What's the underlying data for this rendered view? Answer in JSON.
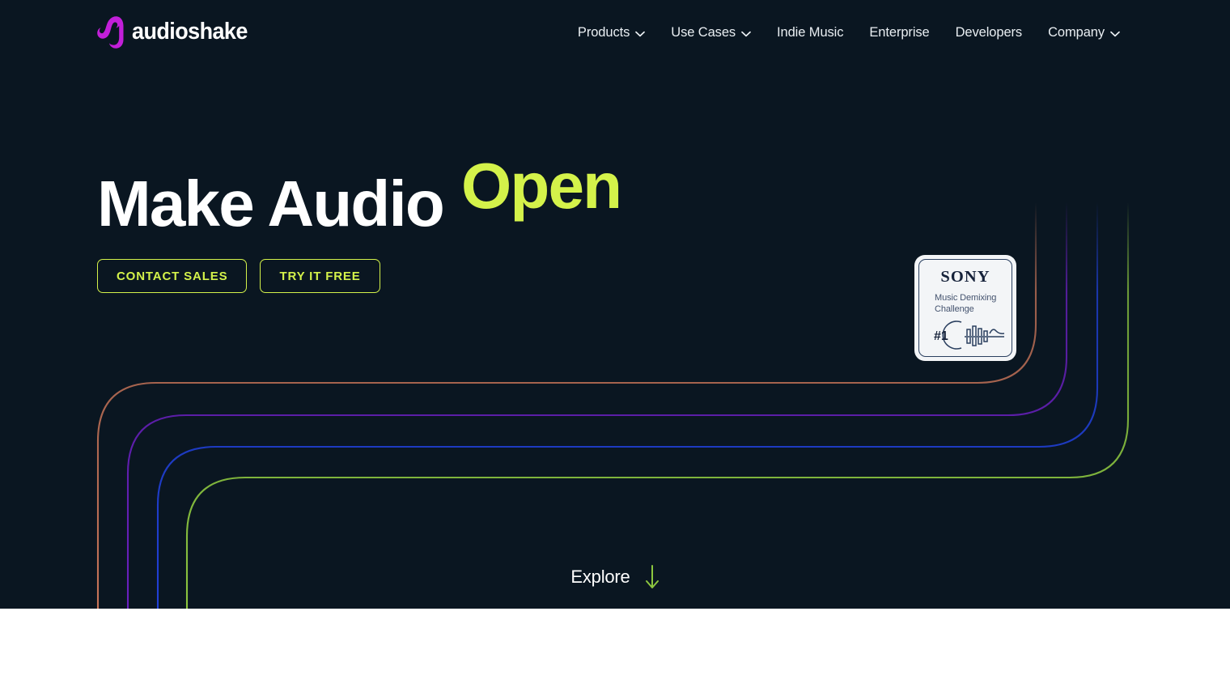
{
  "brand": {
    "name": "audioshake",
    "logo_icon": "audioshake-wave-logo",
    "logo_color": "#c21fd9"
  },
  "nav": {
    "items": [
      {
        "label": "Products",
        "has_dropdown": true,
        "icon": "chevron-down-icon"
      },
      {
        "label": "Use Cases",
        "has_dropdown": true,
        "icon": "chevron-down-icon"
      },
      {
        "label": "Indie Music",
        "has_dropdown": false,
        "icon": ""
      },
      {
        "label": "Enterprise",
        "has_dropdown": false,
        "icon": ""
      },
      {
        "label": "Developers",
        "has_dropdown": false,
        "icon": ""
      },
      {
        "label": "Company",
        "has_dropdown": true,
        "icon": "chevron-down-icon"
      }
    ]
  },
  "hero": {
    "headline_plain": "Make Audio",
    "headline_accent": "Open",
    "accent_color": "#d4f24a",
    "background_color": "#0a1621",
    "buttons": [
      {
        "label": "CONTACT SALES"
      },
      {
        "label": "TRY IT FREE"
      }
    ]
  },
  "badge": {
    "title": "SONY",
    "line1": "Music Demixing",
    "line2": "Challenge",
    "rank": "#1",
    "art_icon": "waveform-icon"
  },
  "explore": {
    "label": "Explore",
    "icon": "arrow-down-icon",
    "icon_color": "#8cc63f"
  },
  "decor": {
    "line_colors": [
      "#c87458",
      "#6a1fc0",
      "#2040d8",
      "#8cc63f"
    ]
  }
}
